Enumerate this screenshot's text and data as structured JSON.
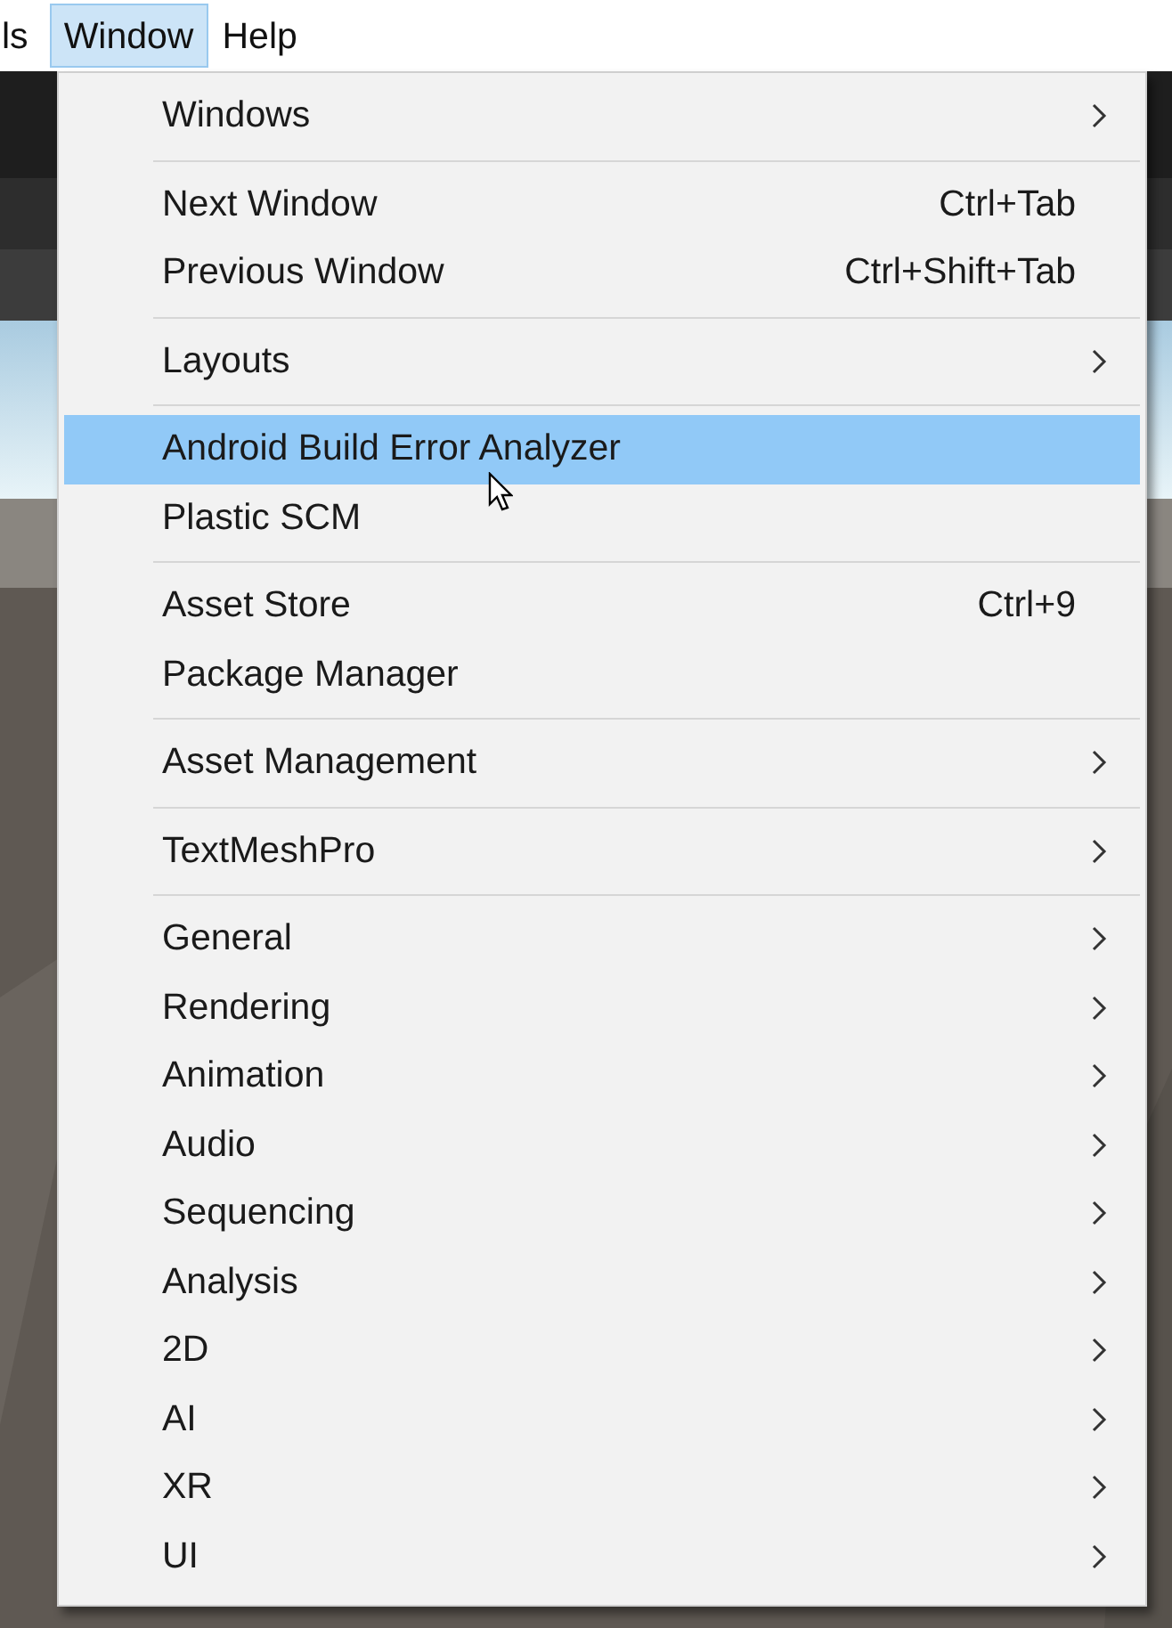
{
  "menubar": {
    "items": [
      {
        "label": "ls",
        "selected": false
      },
      {
        "label": "Window",
        "selected": true
      },
      {
        "label": "Help",
        "selected": false
      }
    ]
  },
  "menu": {
    "items": [
      {
        "kind": "item",
        "label": "Windows",
        "submenu": true,
        "selected": false
      },
      {
        "kind": "separator"
      },
      {
        "kind": "item",
        "label": "Next Window",
        "shortcut": "Ctrl+Tab",
        "submenu": false,
        "selected": false
      },
      {
        "kind": "item",
        "label": "Previous Window",
        "shortcut": "Ctrl+Shift+Tab",
        "submenu": false,
        "selected": false
      },
      {
        "kind": "separator"
      },
      {
        "kind": "item",
        "label": "Layouts",
        "submenu": true,
        "selected": false
      },
      {
        "kind": "separator"
      },
      {
        "kind": "item",
        "label": "Android Build Error Analyzer",
        "submenu": false,
        "selected": true
      },
      {
        "kind": "item",
        "label": "Plastic SCM",
        "submenu": false,
        "selected": false
      },
      {
        "kind": "separator"
      },
      {
        "kind": "item",
        "label": "Asset Store",
        "shortcut": "Ctrl+9",
        "submenu": false,
        "selected": false
      },
      {
        "kind": "item",
        "label": "Package Manager",
        "submenu": false,
        "selected": false
      },
      {
        "kind": "separator"
      },
      {
        "kind": "item",
        "label": "Asset Management",
        "submenu": true,
        "selected": false
      },
      {
        "kind": "separator"
      },
      {
        "kind": "item",
        "label": "TextMeshPro",
        "submenu": true,
        "selected": false
      },
      {
        "kind": "separator"
      },
      {
        "kind": "item",
        "label": "General",
        "submenu": true,
        "selected": false
      },
      {
        "kind": "item",
        "label": "Rendering",
        "submenu": true,
        "selected": false
      },
      {
        "kind": "item",
        "label": "Animation",
        "submenu": true,
        "selected": false
      },
      {
        "kind": "item",
        "label": "Audio",
        "submenu": true,
        "selected": false
      },
      {
        "kind": "item",
        "label": "Sequencing",
        "submenu": true,
        "selected": false
      },
      {
        "kind": "item",
        "label": "Analysis",
        "submenu": true,
        "selected": false
      },
      {
        "kind": "item",
        "label": "2D",
        "submenu": true,
        "selected": false
      },
      {
        "kind": "item",
        "label": "AI",
        "submenu": true,
        "selected": false
      },
      {
        "kind": "item",
        "label": "XR",
        "submenu": true,
        "selected": false
      },
      {
        "kind": "item",
        "label": "UI",
        "submenu": true,
        "selected": false
      }
    ]
  }
}
